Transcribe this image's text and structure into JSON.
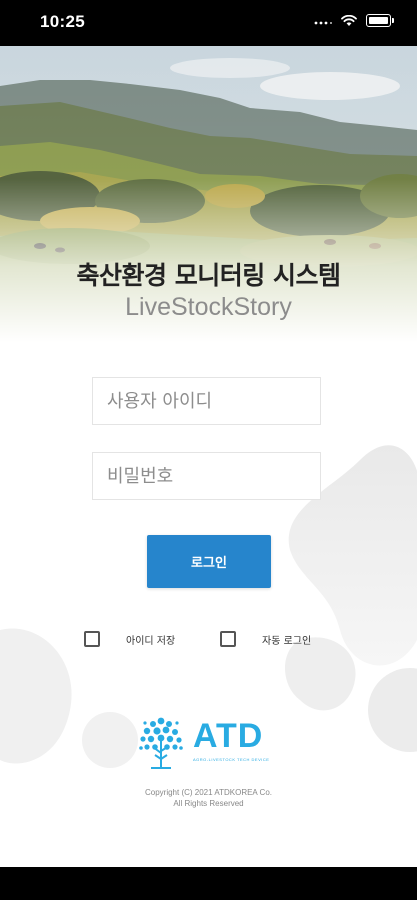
{
  "status_bar": {
    "time": "10:25"
  },
  "app": {
    "title": "축산환경 모니터링 시스템",
    "subtitle": "LiveStockStory"
  },
  "login_form": {
    "id_placeholder": "사용자 아이디",
    "password_placeholder": "비밀번호",
    "login_label": "로그인",
    "save_id_label": "아이디 저장",
    "auto_login_label": "자동 로그인"
  },
  "footer": {
    "logo_text": "ATD",
    "logo_tagline": "AGRO-LIVESTOCK TECH DEVICE",
    "copyright_line1": "Copyright (C) 2021 ATDKOREA Co.",
    "copyright_line2": "All Rights Reserved"
  },
  "colors": {
    "accent": "#2685cc",
    "logo": "#29abe2",
    "status_bar": "#000000"
  }
}
